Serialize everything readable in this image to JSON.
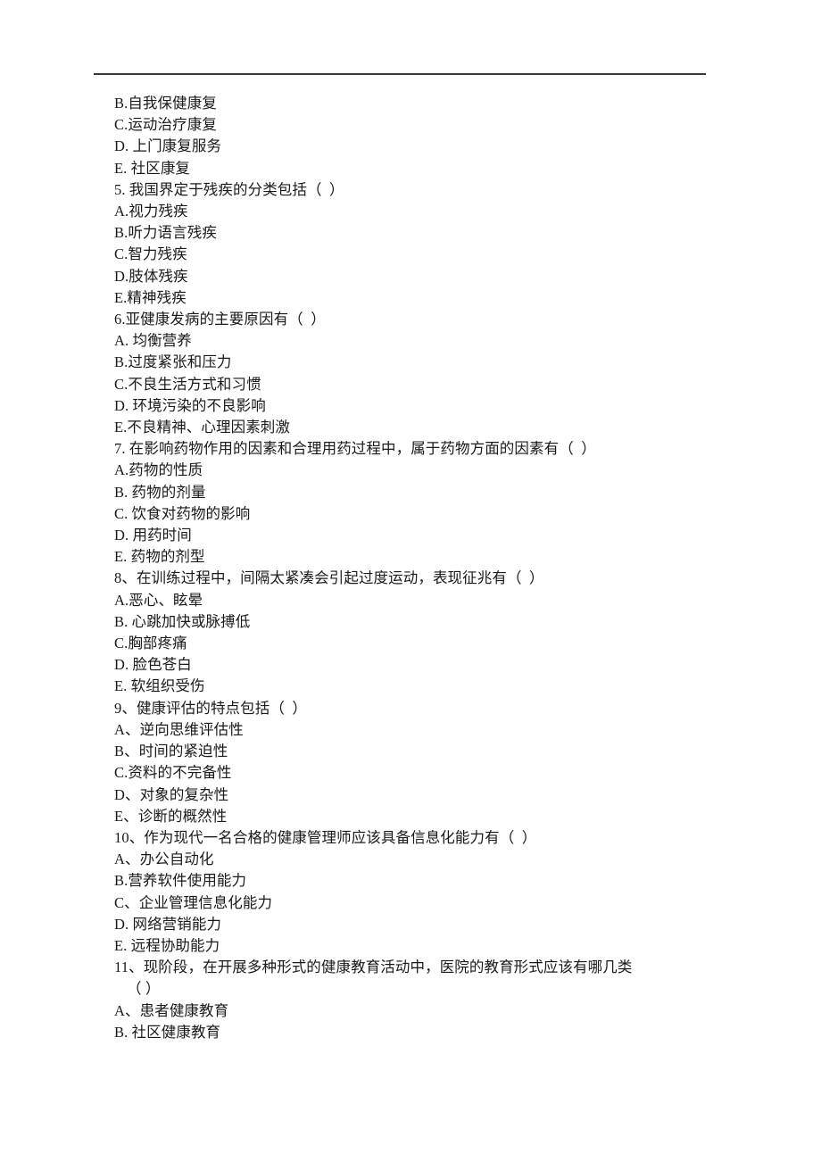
{
  "document": {
    "type": "scanned-exam-paper",
    "language": "zh-CN",
    "page_background": "#ffffff",
    "text_color": "#1a1a1a",
    "rule_color": "#3a3a3a"
  },
  "lines": [
    {
      "id": "l01",
      "text": "B.自我保健康复",
      "wrap": false
    },
    {
      "id": "l02",
      "text": "C.运动治疗康复",
      "wrap": false
    },
    {
      "id": "l03",
      "text": "D. 上门康复服务",
      "wrap": false
    },
    {
      "id": "l04",
      "text": "E. 社区康复",
      "wrap": false
    },
    {
      "id": "l05",
      "text": "5. 我国界定于残疾的分类包括（  ）",
      "wrap": false
    },
    {
      "id": "l06",
      "text": "A.视力残疾",
      "wrap": false
    },
    {
      "id": "l07",
      "text": "B.听力语言残疾",
      "wrap": false
    },
    {
      "id": "l08",
      "text": "C.智力残疾",
      "wrap": false
    },
    {
      "id": "l09",
      "text": "D.肢体残疾",
      "wrap": false
    },
    {
      "id": "l10",
      "text": "E.精神残疾",
      "wrap": false
    },
    {
      "id": "l11",
      "text": "6.亚健康发病的主要原因有（  ）",
      "wrap": false
    },
    {
      "id": "l12",
      "text": "A. 均衡营养",
      "wrap": false
    },
    {
      "id": "l13",
      "text": "B.过度紧张和压力",
      "wrap": false
    },
    {
      "id": "l14",
      "text": "C.不良生活方式和习惯",
      "wrap": false
    },
    {
      "id": "l15",
      "text": "D. 环境污染的不良影响",
      "wrap": false
    },
    {
      "id": "l16",
      "text": "E.不良精神、心理因素刺激",
      "wrap": false
    },
    {
      "id": "l17",
      "text": "7. 在影响药物作用的因素和合理用药过程中，属于药物方面的因素有（  ）",
      "wrap": false
    },
    {
      "id": "l18",
      "text": "A.药物的性质",
      "wrap": false
    },
    {
      "id": "l19",
      "text": "B. 药物的剂量",
      "wrap": false
    },
    {
      "id": "l20",
      "text": "C. 饮食对药物的影响",
      "wrap": false
    },
    {
      "id": "l21",
      "text": "D. 用药时间",
      "wrap": false
    },
    {
      "id": "l22",
      "text": "E. 药物的剂型",
      "wrap": false
    },
    {
      "id": "l23",
      "text": "8、在训练过程中，间隔太紧凑会引起过度运动，表现征兆有（  ）",
      "wrap": false
    },
    {
      "id": "l24",
      "text": "A.恶心、眩晕",
      "wrap": false
    },
    {
      "id": "l25",
      "text": "B. 心跳加快或脉搏低",
      "wrap": false
    },
    {
      "id": "l26",
      "text": "C.胸部疼痛",
      "wrap": false
    },
    {
      "id": "l27",
      "text": "D. 脸色苍白",
      "wrap": false
    },
    {
      "id": "l28",
      "text": "E. 软组织受伤",
      "wrap": false
    },
    {
      "id": "l29",
      "text": "9、健康评估的特点包括（  ）",
      "wrap": false
    },
    {
      "id": "l30",
      "text": "A、逆向思维评估性",
      "wrap": false
    },
    {
      "id": "l31",
      "text": "B、时间的紧迫性",
      "wrap": false
    },
    {
      "id": "l32",
      "text": "C.资料的不完备性",
      "wrap": false
    },
    {
      "id": "l33",
      "text": "D、对象的复杂性",
      "wrap": false
    },
    {
      "id": "l34",
      "text": "E、诊断的概然性",
      "wrap": false
    },
    {
      "id": "l35",
      "text": "10、作为现代一名合格的健康管理师应该具备信息化能力有（  ）",
      "wrap": false
    },
    {
      "id": "l36",
      "text": "A、办公自动化",
      "wrap": false
    },
    {
      "id": "l37",
      "text": "B.营养软件使用能力",
      "wrap": false
    },
    {
      "id": "l38",
      "text": "C、企业管理信息化能力",
      "wrap": false
    },
    {
      "id": "l39",
      "text": "D. 网络营销能力",
      "wrap": false
    },
    {
      "id": "l40",
      "text": "E. 远程协助能力",
      "wrap": false
    },
    {
      "id": "l41",
      "text": "11、现阶段，在开展多种形式的健康教育活动中，医院的教育形式应该有哪几类",
      "wrap": false
    },
    {
      "id": "l42",
      "text": "（ ）",
      "wrap": true
    },
    {
      "id": "l43",
      "text": "A、患者健康教育",
      "wrap": false
    },
    {
      "id": "l44",
      "text": "B. 社区健康教育",
      "wrap": false
    }
  ]
}
